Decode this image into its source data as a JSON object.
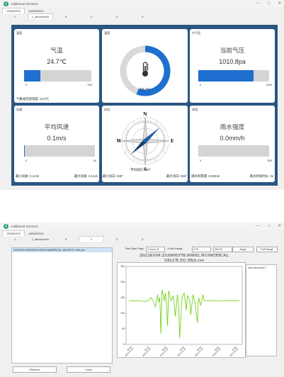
{
  "window": {
    "title": "Additional Sensors",
    "controls": [
      "—",
      "□",
      "✕"
    ]
  },
  "top": {
    "device_tabs": [
      "253000378",
      "4000000002"
    ],
    "sub_tabs": [
      "1",
      "1_atmosphere",
      "5",
      "2",
      "3",
      "4"
    ],
    "active_sub_tab": 1,
    "panels": {
      "temp": {
        "section": "温度",
        "name": "气温",
        "value": "24.7℃",
        "min": "0",
        "max": "100",
        "fill": 0.247,
        "footer": "气象站内部温度: 24.9℃"
      },
      "humidity": {
        "section": "湿度",
        "value": "55.7%",
        "fraction": 0.557,
        "icon": "thermometer-icon"
      },
      "pressure": {
        "section": "大气压",
        "name": "当前气压",
        "value": "1010.8pa",
        "min": "0",
        "max": "1300",
        "fill": 0.7775
      },
      "wind_speed": {
        "section": "风速",
        "name": "平均风速",
        "value": "0.1m/s",
        "min": "0",
        "max": "40",
        "fill": 0.0025,
        "footer_left": "最小风速: 0.1m/s",
        "footer_right": "最大风速: 0.1m/s"
      },
      "wind_dir": {
        "section": "风向",
        "avg": "平均风向: 047°",
        "footer_left": "最小风向: 040°",
        "footer_right": "最大风向: 053°",
        "angle_deg": 47,
        "n": "N",
        "e": "E",
        "s": "S",
        "w": "W"
      },
      "rain": {
        "section": "雨雨",
        "name": "雨水强度",
        "value": "0.0mm/h",
        "min": "0",
        "max": "300",
        "fill": 0,
        "footer_left": "雨水积累量: 0.00mm",
        "footer_right": "雨水持续时长: 0s"
      }
    }
  },
  "bottom": {
    "device_tabs": [
      "253000378",
      "4000000002"
    ],
    "sub_tabs": [
      "1",
      "1_atmosphere",
      "5",
      "2",
      "3",
      "4"
    ],
    "active_sub_tab": 3,
    "file_item": "20230109.253000378.00002.NUMERICAL VALUE.EC-9XA.csv",
    "refresh_label": "Refresh",
    "load_label": "Load",
    "time_span_label": "Time Span Page",
    "time_span_value": "1 hours ▼",
    "yaxis_label": "Y-Axis Range",
    "y_min": "0.00",
    "y_max": "360.00",
    "apply_label": "Apply",
    "full_range_label": "Full Range",
    "chart_title": "20230109.253000378.00002.NUMERICAL VALUE.EC-9XA.csv",
    "legend": "wind direction(°)"
  },
  "chart_data": {
    "type": "line",
    "title": "20230109.253000378.00002.NUMERICAL VALUE.EC-9XA.csv",
    "ylim": [
      0,
      250
    ],
    "yticks": [
      0,
      50,
      100,
      150,
      200,
      250
    ],
    "xtick_labels": [
      "09:00\n2023-01-09",
      "09:10\n2023-01-09",
      "09:20\n2023-01-09",
      "09:30\n2023-01-09",
      "09:40\n2023-01-09",
      "09:50\n2023-01-09",
      "10:00\n2023-01-09"
    ],
    "series": [
      {
        "name": "wind direction(°)",
        "color": "#66cc00",
        "x": [
          0,
          0.05,
          0.1,
          0.14,
          0.17,
          0.2,
          0.22,
          0.24,
          0.26,
          0.27,
          0.28,
          0.29,
          0.3,
          0.32,
          0.33,
          0.34,
          0.35,
          0.36,
          0.38,
          0.4,
          0.41,
          0.42,
          0.44,
          0.45,
          0.46,
          0.48,
          0.5,
          0.52,
          0.53,
          0.55,
          0.56,
          0.58,
          0.6,
          0.62,
          0.63,
          0.65,
          0.67,
          0.68,
          0.7,
          0.72,
          0.74,
          0.76,
          0.78,
          0.8,
          0.82,
          0.85,
          0.88,
          0.9,
          0.93,
          0.96,
          1.0
        ],
        "values": [
          140,
          140,
          139,
          138,
          139,
          150,
          140,
          120,
          160,
          135,
          150,
          35,
          175,
          140,
          165,
          130,
          60,
          172,
          140,
          155,
          130,
          90,
          160,
          125,
          20,
          150,
          165,
          110,
          158,
          140,
          95,
          160,
          130,
          70,
          150,
          125,
          160,
          140,
          140,
          141,
          140,
          139,
          140,
          140,
          139,
          140,
          140,
          140,
          140,
          140,
          140
        ]
      }
    ]
  }
}
